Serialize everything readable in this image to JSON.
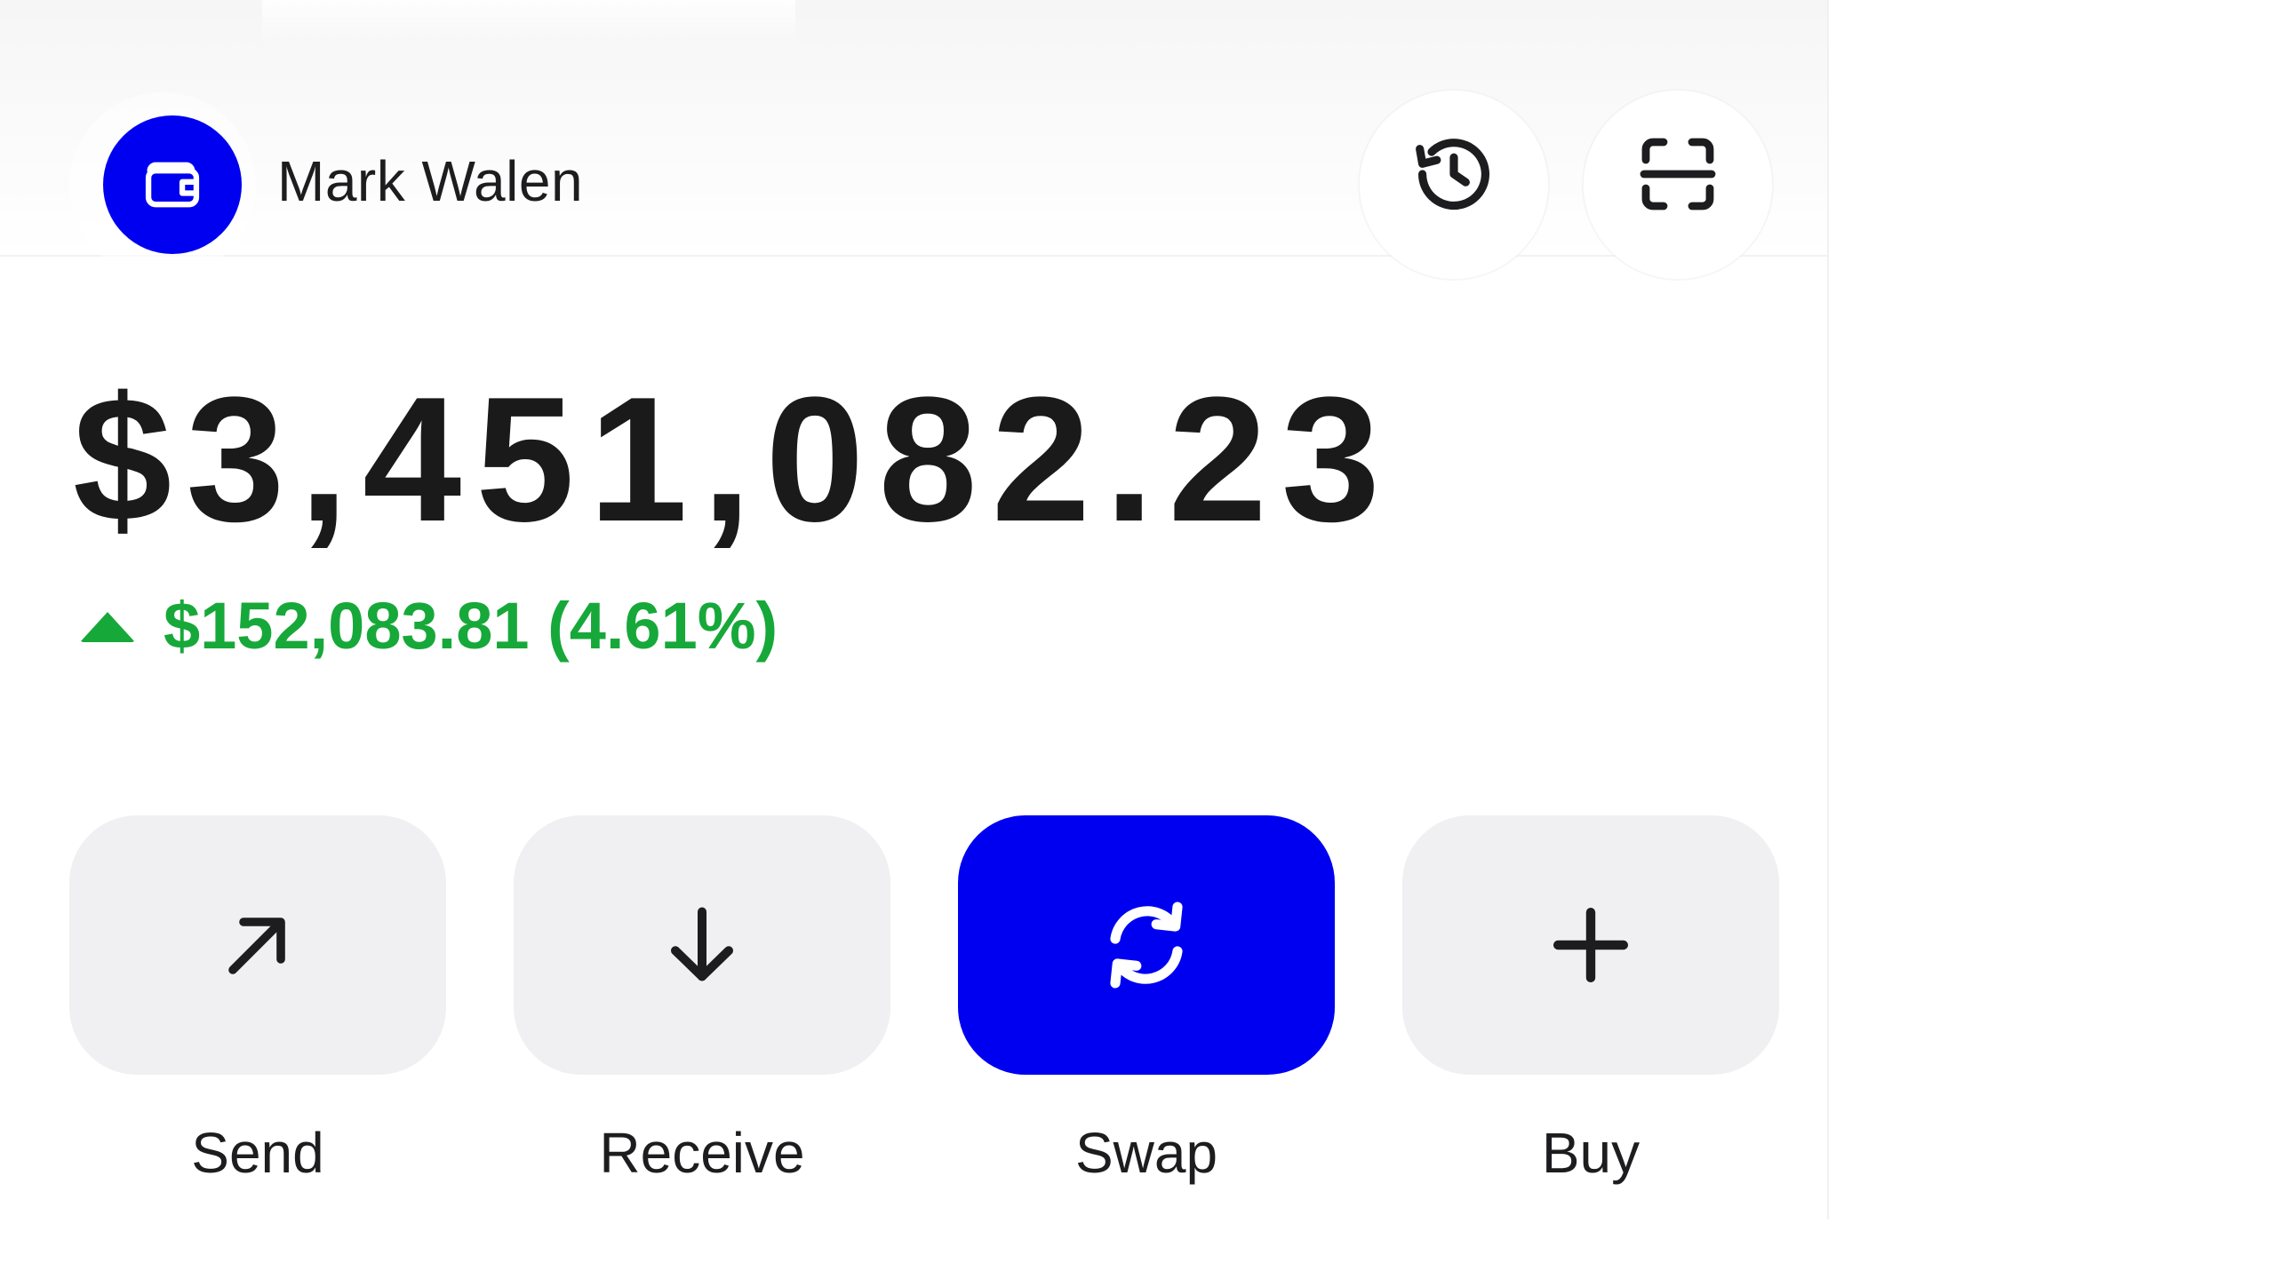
{
  "header": {
    "account_name": "Mark Walen",
    "avatar_icon": "wallet-icon",
    "history_icon": "history-icon",
    "scan_icon": "scan-icon",
    "accent_color": "#0000f0"
  },
  "portfolio": {
    "balance": "$3,451,082.23",
    "change_text": "$152,083.81 (4.61%)",
    "change_direction": "up",
    "change_color": "#17a83a"
  },
  "actions": [
    {
      "label": "Send",
      "icon": "arrow-up-right-icon",
      "primary": false
    },
    {
      "label": "Receive",
      "icon": "arrow-down-icon",
      "primary": false
    },
    {
      "label": "Swap",
      "icon": "swap-icon",
      "primary": true
    },
    {
      "label": "Buy",
      "icon": "plus-icon",
      "primary": false
    }
  ]
}
